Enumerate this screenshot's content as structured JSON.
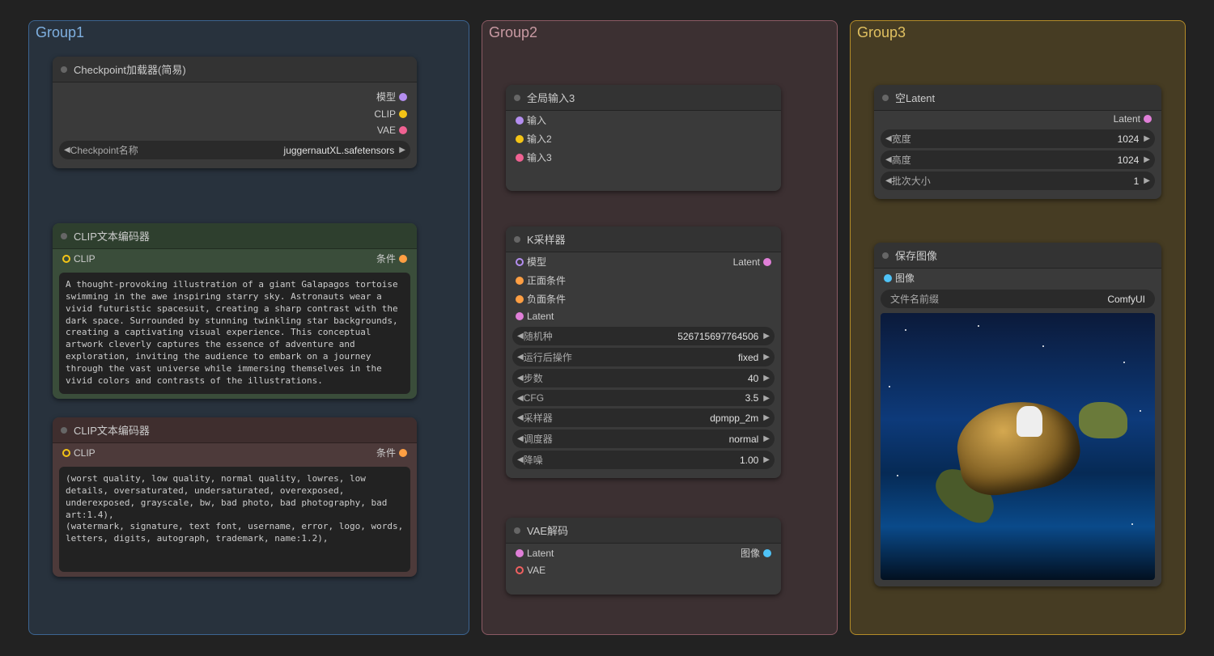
{
  "groups": {
    "g1": "Group1",
    "g2": "Group2",
    "g3": "Group3"
  },
  "nodes": {
    "checkpoint": {
      "title": "Checkpoint加载器(简易)",
      "out_model": "模型",
      "out_clip": "CLIP",
      "out_vae": "VAE",
      "w_name_label": "Checkpoint名称",
      "w_name_value": "juggernautXL.safetensors"
    },
    "clip_pos": {
      "title": "CLIP文本编码器",
      "in_clip": "CLIP",
      "out_cond": "条件",
      "text": "A thought-provoking illustration of a giant Galapagos tortoise swimming in the awe inspiring starry sky. Astronauts wear a vivid futuristic spacesuit, creating a sharp contrast with the dark space. Surrounded by stunning twinkling star backgrounds, creating a captivating visual experience. This conceptual artwork cleverly captures the essence of adventure and exploration, inviting the audience to embark on a journey through the vast universe while immersing themselves in the vivid colors and contrasts of the illustrations."
    },
    "clip_neg": {
      "title": "CLIP文本编码器",
      "in_clip": "CLIP",
      "out_cond": "条件",
      "text": "(worst quality, low quality, normal quality, lowres, low details, oversaturated, undersaturated, overexposed, underexposed, grayscale, bw, bad photo, bad photography, bad art:1.4),\n(watermark, signature, text font, username, error, logo, words, letters, digits, autograph, trademark, name:1.2),"
    },
    "global": {
      "title": "全局输入3",
      "in1": "输入",
      "in2": "输入2",
      "in3": "输入3"
    },
    "ksampler": {
      "title": "K采样器",
      "in_model": "模型",
      "in_pos": "正面条件",
      "in_neg": "负面条件",
      "in_latent": "Latent",
      "out_latent": "Latent",
      "w_seed_l": "随机种",
      "w_seed_v": "526715697764506",
      "w_after_l": "运行后操作",
      "w_after_v": "fixed",
      "w_steps_l": "步数",
      "w_steps_v": "40",
      "w_cfg_l": "CFG",
      "w_cfg_v": "3.5",
      "w_sampler_l": "采样器",
      "w_sampler_v": "dpmpp_2m",
      "w_sched_l": "调度器",
      "w_sched_v": "normal",
      "w_denoise_l": "降噪",
      "w_denoise_v": "1.00"
    },
    "vae_decode": {
      "title": "VAE解码",
      "in_latent": "Latent",
      "in_vae": "VAE",
      "out_image": "图像"
    },
    "empty_latent": {
      "title": "空Latent",
      "out_latent": "Latent",
      "w_w_l": "宽度",
      "w_w_v": "1024",
      "w_h_l": "高度",
      "w_h_v": "1024",
      "w_b_l": "批次大小",
      "w_b_v": "1"
    },
    "save": {
      "title": "保存图像",
      "in_image": "图像",
      "w_prefix_l": "文件名前缀",
      "w_prefix_v": "ComfyUI"
    }
  }
}
